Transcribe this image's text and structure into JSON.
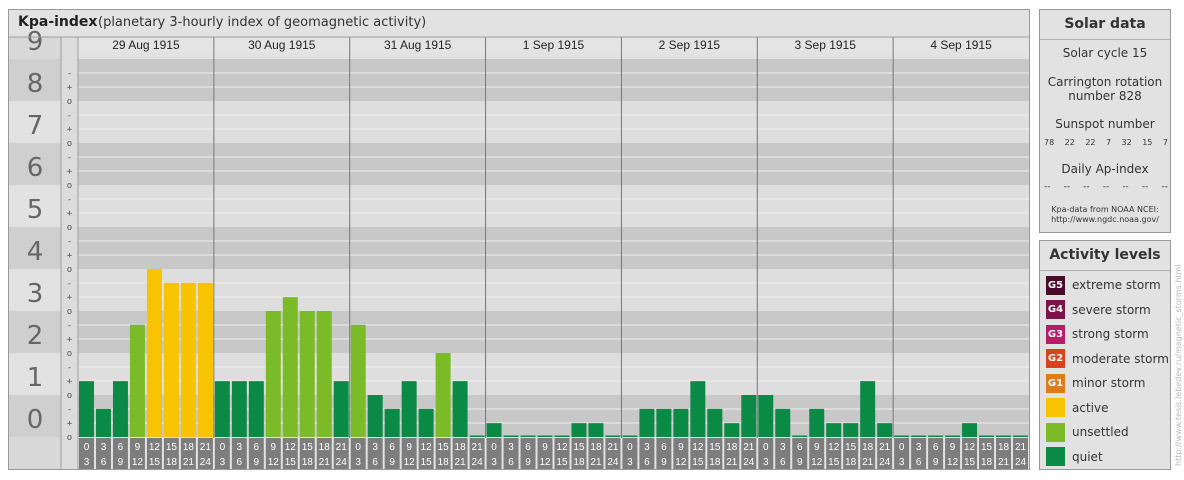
{
  "header": {
    "title": "Kpa-index",
    "subtitle": "(planetary 3-hourly index of geomagnetic activity)"
  },
  "chart_data": {
    "type": "bar",
    "days": [
      "29 Aug 1915",
      "30 Aug 1915",
      "31 Aug 1915",
      "1 Sep 1915",
      "2 Sep 1915",
      "3 Sep 1915",
      "4 Sep 1915"
    ],
    "interval_start_hours": [
      "0",
      "3",
      "6",
      "9",
      "12",
      "15",
      "18",
      "21"
    ],
    "interval_end_hours": [
      "3",
      "6",
      "9",
      "12",
      "15",
      "18",
      "21",
      "24"
    ],
    "ylim": [
      0,
      9
    ],
    "y_ticks": [
      "0",
      "1",
      "2",
      "3",
      "4",
      "5",
      "6",
      "7",
      "8",
      "9"
    ],
    "subtick_labels": [
      "o",
      "+",
      "-"
    ],
    "values": [
      [
        1.33,
        0.67,
        1.33,
        2.67,
        4.0,
        3.67,
        3.67,
        3.67
      ],
      [
        1.33,
        1.33,
        1.33,
        3.0,
        3.33,
        3.0,
        3.0,
        1.33
      ],
      [
        2.67,
        1.0,
        0.67,
        1.33,
        0.67,
        2.0,
        1.33,
        0.0
      ],
      [
        0.33,
        0.0,
        0.0,
        0.0,
        0.0,
        0.33,
        0.33,
        0.0
      ],
      [
        0.0,
        0.67,
        0.67,
        0.67,
        1.33,
        0.67,
        0.33,
        1.0
      ],
      [
        1.0,
        0.67,
        0.0,
        0.67,
        0.33,
        0.33,
        1.33,
        0.33
      ],
      [
        0.0,
        0.0,
        0.0,
        0.0,
        0.33,
        0.0,
        0.0,
        0.0
      ]
    ],
    "colors": {
      "quiet": "#0b8a45",
      "unsettled": "#7cbb28",
      "active": "#f8c300",
      "minor_storm": "#e07b1a"
    },
    "grid": true
  },
  "solar": {
    "title": "Solar data",
    "cycle": "Solar cycle 15",
    "carrington_1": "Carrington rotation",
    "carrington_2": "number 828",
    "sunspot_title": "Sunspot number",
    "sunspot_values": [
      "78",
      "22",
      "22",
      "7",
      "32",
      "15",
      "7"
    ],
    "ap_title": "Daily Ap-index",
    "ap_values": [
      "--",
      "--",
      "--",
      "--",
      "--",
      "--",
      "--"
    ],
    "credit_1": "Kpa-data from NOAA NCEI:",
    "credit_2": "http://www.ngdc.noaa.gov/"
  },
  "levels": {
    "title": "Activity levels",
    "items": [
      {
        "code": "G5",
        "label": "extreme storm",
        "color": "#4a0a2a"
      },
      {
        "code": "G4",
        "label": "severe storm",
        "color": "#7a1448"
      },
      {
        "code": "G3",
        "label": "strong storm",
        "color": "#b81e66"
      },
      {
        "code": "G2",
        "label": "moderate storm",
        "color": "#d9421f"
      },
      {
        "code": "G1",
        "label": "minor storm",
        "color": "#e07b1a"
      },
      {
        "code": "",
        "label": "active",
        "color": "#f8c300"
      },
      {
        "code": "",
        "label": "unsettled",
        "color": "#7cbb28"
      },
      {
        "code": "",
        "label": "quiet",
        "color": "#0b8a45"
      }
    ]
  },
  "watermark": "http://www.tesis.lebedev.ru/magnetic_storms.html"
}
